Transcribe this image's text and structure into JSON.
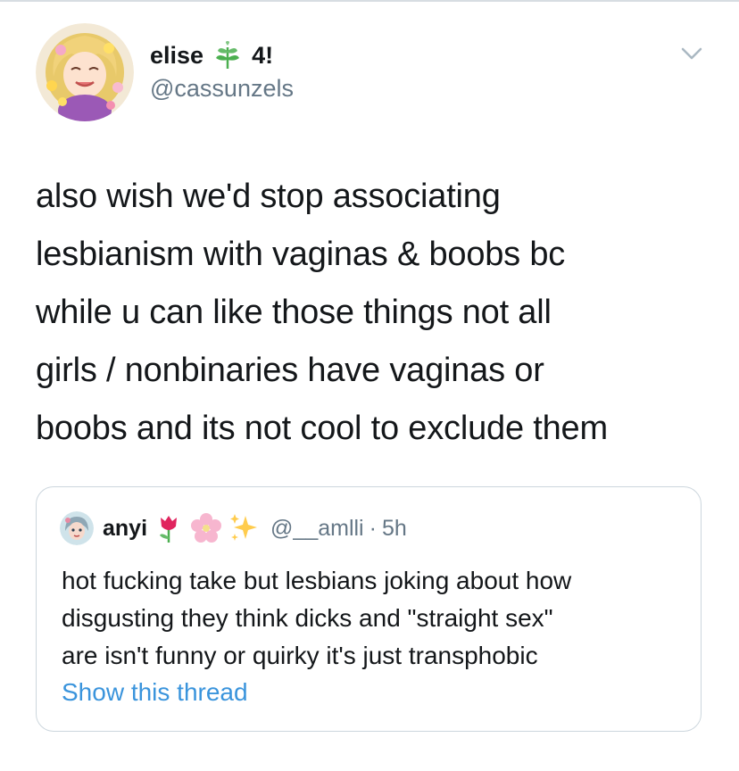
{
  "tweet": {
    "author": {
      "name": "elise",
      "name_suffix": "4!",
      "handle": "@cassunzels",
      "avatar": "rapunzel-avatar",
      "badge_icon": "herb-emoji"
    },
    "text_lines": [
      "also wish we'd stop associating",
      "lesbianism with vaginas & boobs bc",
      "while u can like those things not all",
      "girls / nonbinaries have vaginas or",
      "boobs and its not cool to exclude them"
    ],
    "menu_icon": "chevron-down-icon"
  },
  "quote": {
    "name": "anyi",
    "emojis": [
      "tulip-emoji",
      "cherry-blossom-emoji",
      "sparkles-emoji"
    ],
    "handle": "@__amlli",
    "separator": "·",
    "time": "5h",
    "text_lines": [
      "hot fucking take but lesbians joking about how",
      "disgusting they think dicks and \"straight sex\"",
      "are isn't funny or quirky it's just transphobic"
    ],
    "show_thread": "Show this thread"
  },
  "colors": {
    "text": "#14171a",
    "secondary": "#657786",
    "link": "#3a94dc",
    "border": "#ccd6dd"
  }
}
